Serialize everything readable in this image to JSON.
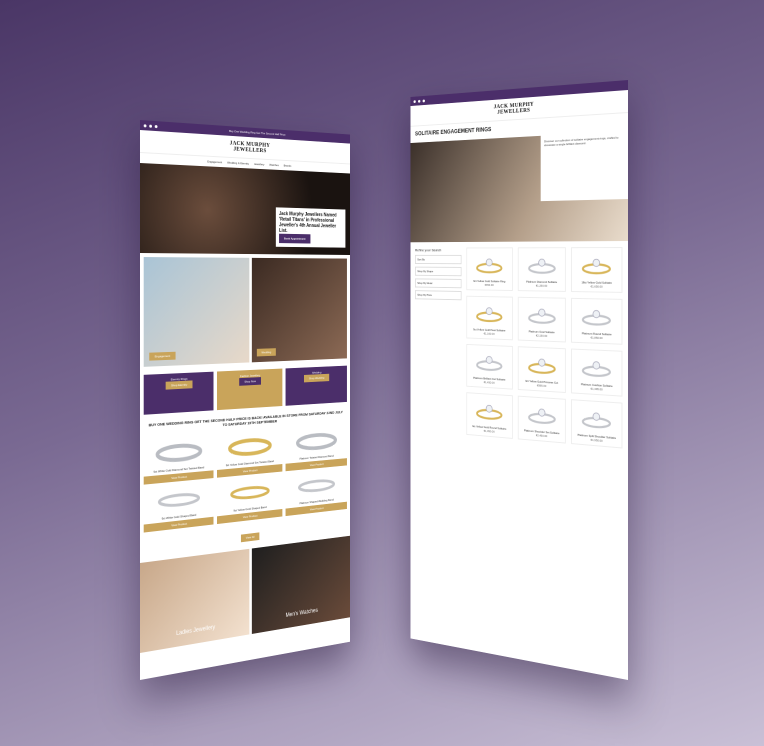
{
  "left": {
    "promo_bar": "Buy One Wedding Ring Get The Second Half Price",
    "logo_line1": "JACK MURPHY",
    "logo_line2": "JEWELLERS",
    "nav": [
      "Engagement",
      "Wedding & Eternity",
      "Jewellery",
      "Watches",
      "Brands"
    ],
    "hero_text": "Jack Murphy Jewellers Named 'Retail Titans' in Professional Jeweller's 4th Annual Jeweller List.",
    "hero_btn": "Book Appointment",
    "photo1_label": "Engagement",
    "photo2_label": "Wedding",
    "cards": [
      {
        "title": "Eternity Rings",
        "btn": "Shop Eternity"
      },
      {
        "title": "Fashion Jewellery",
        "btn": "Shop Now"
      },
      {
        "title": "Wedding",
        "btn": "Shop Wedding"
      }
    ],
    "promo_heading": "BUY ONE WEDDING RING GET THE SECOND HALF PRICE IS BACK! AVAILABLE IN STORE FROM SATURDAY 22ND JULY TO SATURDAY 19TH SEPTEMBER",
    "products": [
      {
        "name": "9ct White Gold Diamond Set Twisted Band",
        "btn": "View Product"
      },
      {
        "name": "9ct Yellow Gold Diamond Set Twisted Band",
        "btn": "View Product"
      },
      {
        "name": "Platinum Twisted Diamond Band",
        "btn": "View Product"
      },
      {
        "name": "9ct White Gold Shaped Band",
        "btn": "View Product"
      },
      {
        "name": "9ct Yellow Gold Shaped Band",
        "btn": "View Product"
      },
      {
        "name": "Platinum Shaped Wedding Band",
        "btn": "View Product"
      }
    ],
    "view_all": "View All",
    "banner_ladies": "Ladies Jewellery",
    "banner_mens": "Men's Watches"
  },
  "right": {
    "title": "SOLITAIRE ENGAGEMENT RINGS",
    "desc": "Discover our collection of solitaire engagement rings, crafted to showcase a single brilliant diamond.",
    "filters_title": "Refine your Search",
    "filters": [
      "Sort By",
      "Shop By Shape",
      "Shop By Metal",
      "Shop By Price"
    ],
    "products": [
      {
        "name": "9ct Yellow Gold Solitaire Ring",
        "price": "€950.00"
      },
      {
        "name": "Platinum Diamond Solitaire",
        "price": "€1,250.00"
      },
      {
        "name": "18ct Yellow Gold Solitaire",
        "price": "€1,650.00"
      },
      {
        "name": "9ct Yellow Gold Pear Solitaire",
        "price": "€1,100.00"
      },
      {
        "name": "Platinum Oval Solitaire",
        "price": "€2,150.00"
      },
      {
        "name": "Platinum Round Solitaire",
        "price": "€1,850.00"
      },
      {
        "name": "Platinum Brilliant Cut Solitaire",
        "price": "€1,450.00"
      },
      {
        "name": "9ct Yellow Gold Princess Cut",
        "price": "€995.00"
      },
      {
        "name": "Platinum Cushion Solitaire",
        "price": "€1,395.00"
      },
      {
        "name": "9ct Yellow Gold Round Solitaire",
        "price": "€1,050.00"
      },
      {
        "name": "Platinum Shoulder Set Solitaire",
        "price": "€2,450.00"
      },
      {
        "name": "Platinum Split Shoulder Solitaire",
        "price": "€1,950.00"
      }
    ]
  }
}
